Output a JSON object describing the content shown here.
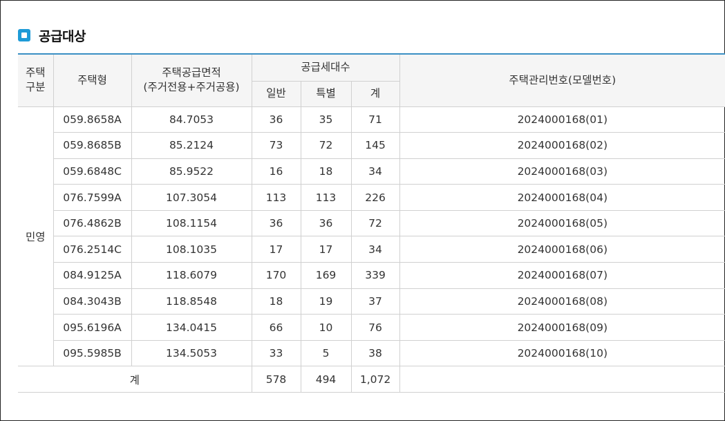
{
  "section": {
    "title": "공급대상",
    "icon": "square-bullet-icon",
    "accent": "#1e9bd7",
    "border": "#3a8fc4"
  },
  "table": {
    "headers": {
      "type_group": "주택\n구분",
      "house_type": "주택형",
      "area": "주택공급면적\n(주거전용+주거공용)",
      "supply_count": "공급세대수",
      "general": "일반",
      "special": "특별",
      "total": "계",
      "mgmt_no": "주택관리번호(모델번호)"
    },
    "category": "민영",
    "rows": [
      {
        "type": "059.8658A",
        "area": "84.7053",
        "general": "36",
        "special": "35",
        "total": "71",
        "mgmt_no": "2024000168(01)"
      },
      {
        "type": "059.8685B",
        "area": "85.2124",
        "general": "73",
        "special": "72",
        "total": "145",
        "mgmt_no": "2024000168(02)"
      },
      {
        "type": "059.6848C",
        "area": "85.9522",
        "general": "16",
        "special": "18",
        "total": "34",
        "mgmt_no": "2024000168(03)"
      },
      {
        "type": "076.7599A",
        "area": "107.3054",
        "general": "113",
        "special": "113",
        "total": "226",
        "mgmt_no": "2024000168(04)"
      },
      {
        "type": "076.4862B",
        "area": "108.1154",
        "general": "36",
        "special": "36",
        "total": "72",
        "mgmt_no": "2024000168(05)"
      },
      {
        "type": "076.2514C",
        "area": "108.1035",
        "general": "17",
        "special": "17",
        "total": "34",
        "mgmt_no": "2024000168(06)"
      },
      {
        "type": "084.9125A",
        "area": "118.6079",
        "general": "170",
        "special": "169",
        "total": "339",
        "mgmt_no": "2024000168(07)"
      },
      {
        "type": "084.3043B",
        "area": "118.8548",
        "general": "18",
        "special": "19",
        "total": "37",
        "mgmt_no": "2024000168(08)"
      },
      {
        "type": "095.6196A",
        "area": "134.0415",
        "general": "66",
        "special": "10",
        "total": "76",
        "mgmt_no": "2024000168(09)"
      },
      {
        "type": "095.5985B",
        "area": "134.5053",
        "general": "33",
        "special": "5",
        "total": "38",
        "mgmt_no": "2024000168(10)"
      }
    ],
    "footer": {
      "label": "계",
      "general": "578",
      "special": "494",
      "total": "1,072",
      "mgmt_no": ""
    }
  }
}
